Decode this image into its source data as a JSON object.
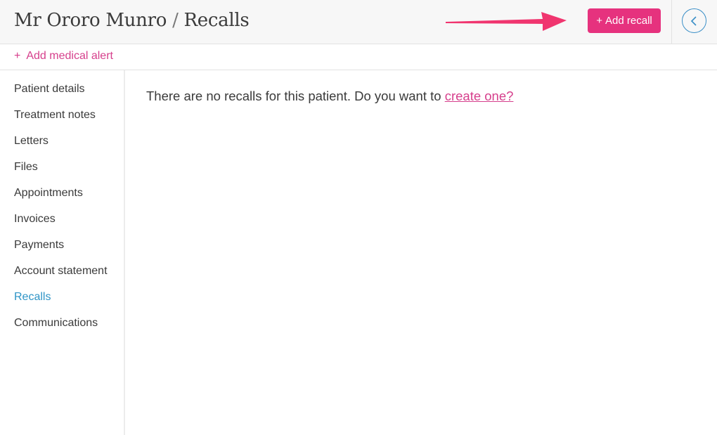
{
  "header": {
    "patient_name": "Mr Ororo Munro",
    "separator": "/",
    "section": "Recalls",
    "add_recall_label": "Add recall",
    "add_recall_icon": "plus-icon",
    "back_icon": "chevron-left-icon"
  },
  "alert_bar": {
    "add_alert_label": "Add medical alert",
    "add_alert_icon": "plus-icon"
  },
  "sidebar": {
    "items": [
      {
        "label": "Patient details",
        "active": false
      },
      {
        "label": "Treatment notes",
        "active": false
      },
      {
        "label": "Letters",
        "active": false
      },
      {
        "label": "Files",
        "active": false
      },
      {
        "label": "Appointments",
        "active": false
      },
      {
        "label": "Invoices",
        "active": false
      },
      {
        "label": "Payments",
        "active": false
      },
      {
        "label": "Account statement",
        "active": false
      },
      {
        "label": "Recalls",
        "active": true
      },
      {
        "label": "Communications",
        "active": false
      }
    ]
  },
  "main": {
    "empty_message": "There are no recalls for this patient. Do you want to",
    "create_link": "create one?"
  },
  "annotation": {
    "type": "arrow",
    "points_to": "add-recall-button",
    "color": "#f0356f"
  },
  "colors": {
    "accent_pink": "#e6327e",
    "link_pink": "#d63f8c",
    "active_blue": "#2e94c6",
    "back_button_blue": "#3a8fc7"
  }
}
